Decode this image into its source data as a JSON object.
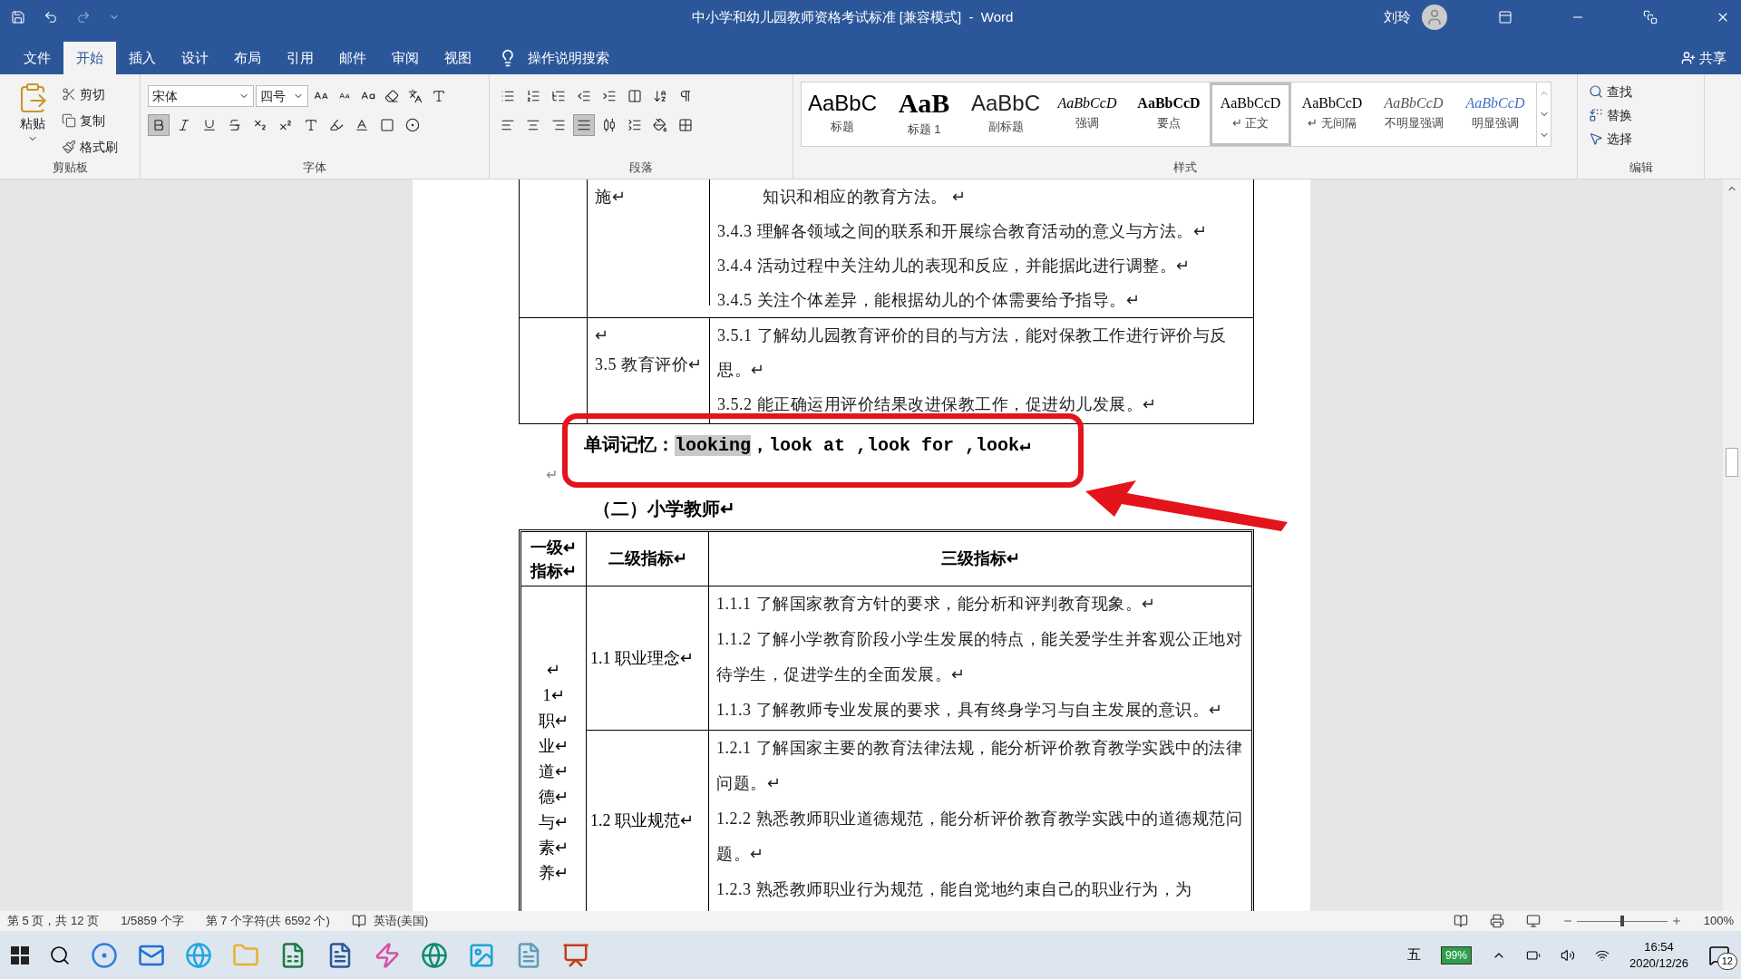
{
  "title_bar": {
    "title": "中小学和幼儿园教师资格考试标准 [兼容模式]  -  Word",
    "user": "刘玲"
  },
  "tabs": [
    {
      "label": "文件",
      "selected": false
    },
    {
      "label": "开始",
      "selected": true
    },
    {
      "label": "插入",
      "selected": false
    },
    {
      "label": "设计",
      "selected": false
    },
    {
      "label": "布局",
      "selected": false
    },
    {
      "label": "引用",
      "selected": false
    },
    {
      "label": "邮件",
      "selected": false
    },
    {
      "label": "审阅",
      "selected": false
    },
    {
      "label": "视图",
      "selected": false
    }
  ],
  "tell_me": "操作说明搜索",
  "share": "共享",
  "clipboard": {
    "label": "剪贴板",
    "paste": "粘贴",
    "items": [
      "剪切",
      "复制",
      "格式刷"
    ]
  },
  "font": {
    "label": "字体",
    "name": "宋体",
    "size": "四号",
    "bold": true
  },
  "paragraph": {
    "label": "段落",
    "alignments": [
      {
        "kind": "left",
        "selected": false
      },
      {
        "kind": "center",
        "selected": false
      },
      {
        "kind": "right",
        "selected": false
      },
      {
        "kind": "justify",
        "selected": true
      },
      {
        "kind": "distributed",
        "selected": false
      }
    ]
  },
  "styles": {
    "label": "样式",
    "items": [
      {
        "preview": "AaBbC",
        "label": "标题",
        "kind": "title",
        "selected": false
      },
      {
        "preview": "AaB",
        "label": "标题 1",
        "kind": "heading",
        "selected": false
      },
      {
        "preview": "AaBbC",
        "label": "副标题",
        "kind": "subtitle",
        "selected": false
      },
      {
        "preview": "AaBbCcD",
        "label": "强调",
        "kind": "emphasis",
        "selected": false
      },
      {
        "preview": "AaBbCcD",
        "label": "要点",
        "kind": "strong",
        "selected": false
      },
      {
        "preview": "AaBbCcD",
        "label": "↵ 正文",
        "kind": "normal",
        "selected": true
      },
      {
        "preview": "AaBbCcD",
        "label": "↵ 无间隔",
        "kind": "normal",
        "selected": false
      },
      {
        "preview": "AaBbCcD",
        "label": "不明显强调",
        "kind": "subtle",
        "selected": false
      },
      {
        "preview": "AaBbCcD",
        "label": "明显强调",
        "kind": "intense",
        "selected": false
      }
    ]
  },
  "editing": {
    "label": "编辑",
    "items": [
      "查找",
      "替换",
      "选择"
    ]
  },
  "document": {
    "table_1": {
      "rows": [
        {
          "col_2": [
            "施↵"
          ],
          "col_3": [
            "知识和相应的教育方法。 ↵",
            "3.4.3 理解各领域之间的联系和开展综合教育活动的意义与方法。↵",
            "3.4.4 活动过程中关注幼儿的表现和反应，并能据此进行调整。↵",
            "3.4.5 关注个体差异，能根据幼儿的个体需要给予指导。↵"
          ]
        },
        {
          "col_2": [
            "↵",
            "3.5 教育评价↵"
          ],
          "col_3": [
            "3.5.1 了解幼儿园教育评价的目的与方法，能对保教工作进行评价与反思。↵",
            "3.5.2 能正确运用评价结果改进保教工作，促进幼儿发展。↵"
          ]
        }
      ]
    },
    "word_memory": [
      {
        "text": "单词记忆：",
        "highlighted": false
      },
      {
        "text": "looking",
        "highlighted": true
      },
      {
        "text": "，look at ,look for ,look↵",
        "highlighted": false
      }
    ],
    "empty_paragraph": "↵",
    "heading": "（二）小学教师↵",
    "table_2": {
      "columns": [
        "一级↵ 指标↵",
        "二级指标↵",
        "三级指标↵"
      ],
      "level_1": [
        "↵",
        "1↵",
        "职↵",
        "业↵",
        "道↵",
        "德↵",
        "与↵",
        "素↵",
        "养↵"
      ],
      "rows": [
        {
          "col_2": "1.1 职业理念↵",
          "col_3": [
            "1.1.1 了解国家教育方针的要求，能分析和评判教育现象。↵",
            "1.1.2 了解小学教育阶段小学生发展的特点，能关爱学生并客观公正地对待学生，促进学生的全面发展。↵",
            "1.1.3 了解教师专业发展的要求，具有终身学习与自主发展的意识。↵"
          ]
        },
        {
          "col_2": "1.2 职业规范↵",
          "col_3": [
            "1.2.1 了解国家主要的教育法律法规，能分析评价教育教学实践中的法律问题。↵",
            "1.2.2 熟悉教师职业道德规范，能分析评价教育教学实践中的道德规范问题。↵",
            "1.2.3 熟悉教师职业行为规范，能自觉地约束自己的职业行为，为"
          ]
        }
      ]
    }
  },
  "status_bar": {
    "items": [
      "第 5 页，共 12 页",
      "1/5859 个字",
      "第 7 个字符(共 6592 个)"
    ],
    "language": "英语(美国)",
    "zoom": {
      "text": "100%",
      "level": 0.5
    }
  },
  "taskbar": {
    "ime": "五",
    "battery": "99%",
    "time": "16:54",
    "date": "2020/12/26",
    "notifications": "12"
  }
}
